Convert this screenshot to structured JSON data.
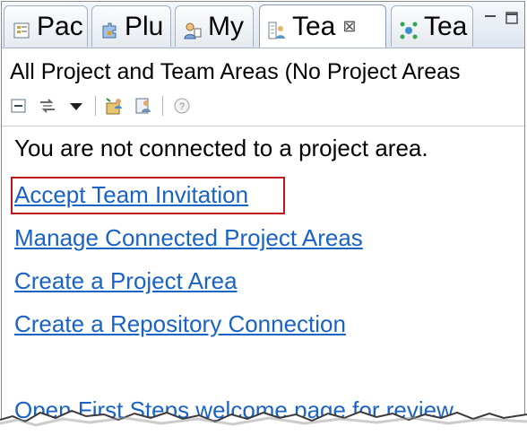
{
  "tabs": [
    {
      "label": "Pac",
      "icon": "package-explorer-icon",
      "active": false
    },
    {
      "label": "Plu",
      "icon": "plugins-icon",
      "active": false
    },
    {
      "label": "My",
      "icon": "my-work-icon",
      "active": false
    },
    {
      "label": "Tea",
      "icon": "team-artifacts-icon",
      "active": true,
      "close": "⊠"
    },
    {
      "label": "Tea",
      "icon": "team-organization-icon",
      "active": false
    }
  ],
  "view": {
    "title": "All Project and Team Areas (No Project Areas",
    "toolbar_icons": [
      "collapse-all-icon",
      "sync-icon",
      "view-menu-icon",
      "project-area-icon",
      "team-area-icon",
      "help-icon"
    ]
  },
  "content": {
    "message": "You are not connected to a project area.",
    "links": {
      "accept": "Accept Team Invitation",
      "manage": "Manage Connected Project Areas",
      "create_project": "Create a Project Area",
      "create_connection": "Create a Repository Connection",
      "first_steps": "Open First Steps welcome page for review"
    }
  },
  "colors": {
    "link": "#1a63c6",
    "highlight": "#c0161b"
  }
}
